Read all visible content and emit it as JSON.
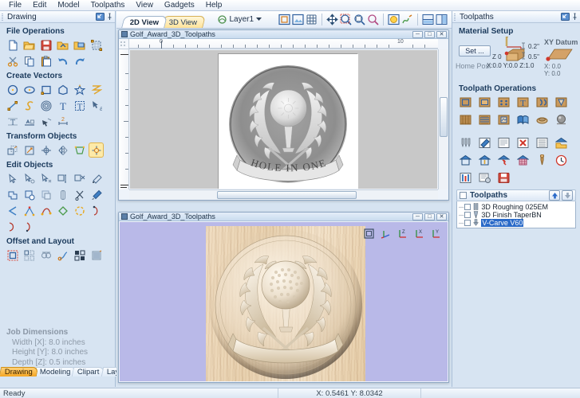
{
  "menu": {
    "items": [
      "File",
      "Edit",
      "Model",
      "Toolpaths",
      "View",
      "Gadgets",
      "Help"
    ]
  },
  "left_panel": {
    "title": "Drawing",
    "pin_icon": "pin-icon",
    "float_icon": "float-icon",
    "sections": [
      {
        "title": "File Operations",
        "icons": [
          "new-file-icon",
          "open-file-icon",
          "save-file-icon",
          "import-vectors-icon",
          "import-bitmap-icon",
          "job-setup-icon",
          "cut-icon",
          "copy-icon",
          "paste-icon",
          "undo-icon",
          "redo-icon"
        ]
      },
      {
        "title": "Create Vectors",
        "icons": [
          "circle-icon",
          "ellipse-icon",
          "rectangle-icon",
          "polygon-icon",
          "star-icon",
          "polyline-icon",
          "draw-curve-icon",
          "s-curve-icon",
          "spiral-icon",
          "create-text-icon",
          "edit-text-icon",
          "text-selection-icon",
          "text-on-curve-icon",
          "auto-text-layout-icon",
          "dimension-arrow-icon",
          "dimension-tool-icon"
        ]
      },
      {
        "title": "Transform Objects",
        "icons": [
          "move-icon",
          "scale-icon",
          "rotate-icon",
          "mirror-icon",
          "distort-icon",
          "align-icon"
        ]
      },
      {
        "title": "Edit Objects",
        "icons": [
          "node-edit-icon",
          "select-node-icon",
          "select-point-icon",
          "measure-icon",
          "delete-point-icon",
          "spray-icon",
          "weld-icon",
          "subtract-icon",
          "intersect-icon",
          "trim-icon",
          "scissors-icon",
          "paint-icon",
          "fillet-icon",
          "node-point-icon",
          "curve-fit-icon",
          "close-vector-icon",
          "join-vectors-icon",
          "open-curve-icon",
          "arc-icon",
          "curve-segment-icon"
        ]
      },
      {
        "title": "Offset and Layout",
        "icons": [
          "offset-icon",
          "array-copy-icon",
          "nest-icon",
          "join-curve-icon",
          "block-copy-icon",
          "plate-layout-icon"
        ]
      }
    ],
    "job_dimensions": {
      "title": "Job Dimensions",
      "rows": [
        "Width  [X]: 8.0 inches",
        "Height [Y]: 8.0 inches",
        "Depth  [Z]: 0.5 inches"
      ]
    },
    "tabs": [
      {
        "label": "Drawing",
        "active": true
      },
      {
        "label": "Modeling",
        "active": false
      },
      {
        "label": "Clipart",
        "active": false
      },
      {
        "label": "Layers",
        "active": false
      }
    ]
  },
  "view_toolbar": {
    "tabs": [
      {
        "label": "2D View",
        "active": true
      },
      {
        "label": "3D View",
        "active": false
      }
    ],
    "layer": {
      "label": "Layer1",
      "icon": "layer-icon",
      "caret": "chevron-down-icon"
    },
    "icons": [
      "toggle-vectors-icon",
      "toggle-bitmap-icon",
      "toggle-grid-icon",
      "pan-icon",
      "zoom-window-icon",
      "zoom-extents-icon",
      "zoom-selected-icon",
      "toggle-shading-icon",
      "toggle-toolpaths-icon",
      "tile-windows-icon",
      "split-windows-icon"
    ]
  },
  "window_2d": {
    "title": "Golf_Award_3D_Toolpaths",
    "icon": "window-icon",
    "buttons": [
      "minimize-button",
      "maximize-button",
      "close-button"
    ],
    "ruler": {
      "labels": [
        "0",
        "10"
      ],
      "units": "inches"
    },
    "artwork_alt": "Golf award greyscale relief with laurel wreath, golf ball on tee and HOLE IN ONE banner",
    "banner_text": "HOLE IN ONE"
  },
  "window_3d": {
    "title": "Golf_Award_3D_Toolpaths",
    "icon": "window-icon",
    "buttons": [
      "minimize-button",
      "maximize-button",
      "close-button"
    ],
    "view_icons": [
      "isometric-view-icon",
      "xyz-axis-icon",
      "z-axis-view-icon",
      "x-axis-view-icon",
      "y-axis-view-icon"
    ],
    "artwork_alt": "3D wood-grain rendered golf award relief"
  },
  "right_panel": {
    "title": "Toolpaths",
    "pin_icon": "pin-icon",
    "float_icon": "float-icon",
    "material_setup": {
      "heading": "Material Setup",
      "set_button": "Set ...",
      "thickness_top": "0.2\"",
      "thickness_bottom": "0.5\"",
      "zero_label": "Z 0",
      "home_label": "Home Pos:",
      "home_value": "X:0.0 Y:0.0 Z:1.0",
      "datum": {
        "heading": "XY Datum",
        "x": "X: 0.0",
        "y": "Y: 0.0"
      }
    },
    "operations": {
      "heading": "Toolpath Operations",
      "icons": [
        "profile-toolpath-icon",
        "pocket-toolpath-icon",
        "drilling-toolpath-icon",
        "vcarve-toolpath-icon",
        "fluting-toolpath-icon",
        "prism-carving-icon",
        "texture-toolpath-icon",
        "3d-roughing-icon",
        "3d-finishing-icon",
        "inlay-toolpath-icon",
        "rotary-toolpath-icon",
        "3d-ball-icon",
        "tool-database-icon",
        "edit-toolpath-icon",
        "copy-toolpath-icon",
        "delete-toolpath-icon",
        "recalculate-icon",
        "preview-open-icon",
        "preview-toolpath-icon",
        "preview-all-icon",
        "simulate-icon",
        "preview-reset-icon",
        "toolchange-icon",
        "estimate-time-icon",
        "tool-list-icon",
        "toolpath-settings-icon",
        "save-toolpath-icon"
      ]
    },
    "toolpath_list": {
      "header": "Toolpaths",
      "move_up_icon": "arrow-up-icon",
      "move_down_icon": "arrow-down-icon",
      "items": [
        {
          "name": "3D Roughing 025EM",
          "icon": "endmill-icon",
          "checked": false,
          "selected": false
        },
        {
          "name": "3D Finish TaperBN",
          "icon": "taper-ball-nose-icon",
          "checked": false,
          "selected": false
        },
        {
          "name": "V-Carve V60",
          "icon": "vbit-icon",
          "checked": false,
          "selected": true
        }
      ]
    }
  },
  "status_bar": {
    "ready": "Ready",
    "coordinates": "X: 0.5461 Y: 8.0342"
  },
  "colors": {
    "panel_bg": "#d7e4f2",
    "accent_tab": "#f5a623",
    "selection": "#2a6ac8",
    "canvas_grey": "#c8c8c8",
    "canvas_3d_bg": "#b9b9e8",
    "wood": "#e8d1af"
  }
}
